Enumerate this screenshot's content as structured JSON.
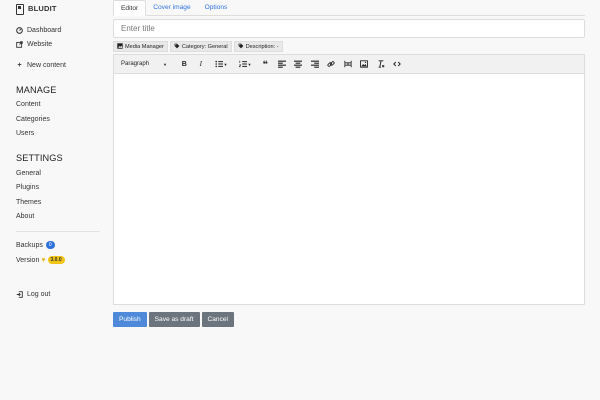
{
  "brand": {
    "name": "BLUDIT"
  },
  "sidebar": {
    "dashboard": "Dashboard",
    "website": "Website",
    "new_content": "New content",
    "manage": {
      "title": "MANAGE",
      "items": [
        "Content",
        "Categories",
        "Users"
      ]
    },
    "settings": {
      "title": "SETTINGS",
      "items": [
        "General",
        "Plugins",
        "Themes",
        "About"
      ]
    },
    "backups": {
      "label": "Backups",
      "count": "0"
    },
    "version": {
      "label": "Version",
      "value": "3.0.0"
    },
    "logout": "Log out"
  },
  "tabs": [
    "Editor",
    "Cover image",
    "Options"
  ],
  "title_input": {
    "placeholder": "Enter title",
    "value": ""
  },
  "meta": {
    "media_manager": "Media Manager",
    "category": "Category: General",
    "description": "Description: -"
  },
  "toolbar": {
    "format": "Paragraph",
    "icons": [
      "bold-icon",
      "italic-icon",
      "bullet-list-icon",
      "numbered-list-icon",
      "blockquote-icon",
      "align-left-icon",
      "align-center-icon",
      "align-right-icon",
      "link-icon",
      "page-break-icon",
      "image-icon",
      "clear-format-icon",
      "code-icon"
    ]
  },
  "actions": {
    "publish": "Publish",
    "save_draft": "Save as draft",
    "cancel": "Cancel"
  },
  "colors": {
    "accent": "#2e72db",
    "primary_button": "#4e8ad9",
    "secondary_button": "#6c757d",
    "version_badge": "#f0c419"
  }
}
